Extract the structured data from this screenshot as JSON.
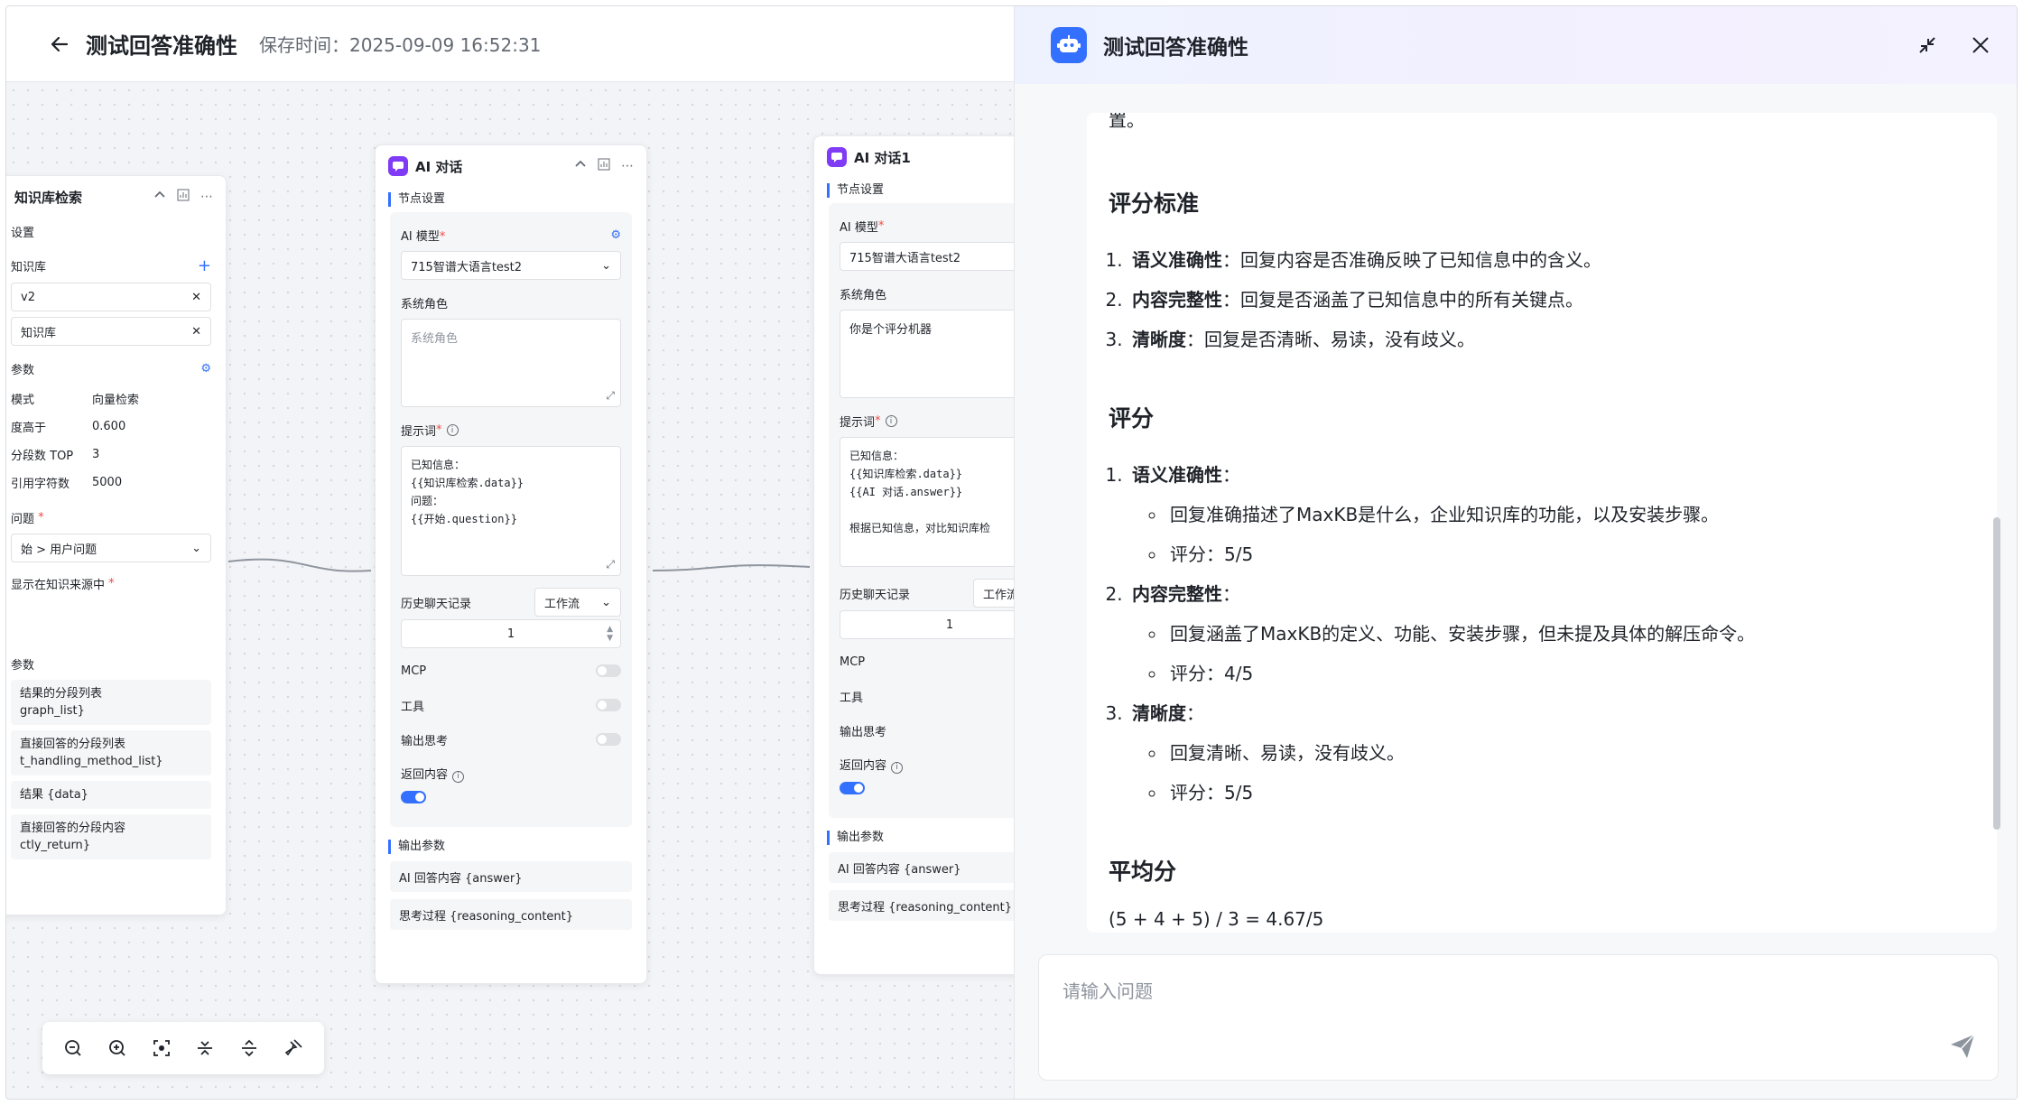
{
  "header": {
    "title": "测试回答准确性",
    "save_time": "保存时间：2025-09-09 16:52:31"
  },
  "kb_node": {
    "title": "知识库检索",
    "settings_label": "设置",
    "kb_label": "知识库",
    "kb_items": [
      "v2",
      "知识库"
    ],
    "params_label": "参数",
    "params": [
      {
        "k": "模式",
        "v": "向量检索"
      },
      {
        "k": "度高于",
        "v": "0.600"
      },
      {
        "k": "分段数 TOP",
        "v": "3"
      },
      {
        "k": "引用字符数",
        "v": "5000"
      }
    ],
    "question_label": "问题",
    "question_value": "始 > 用户问题",
    "show_source_label": "显示在知识来源中",
    "output_label": "参数",
    "outputs": [
      "结果的分段列表\ngraph_list}",
      "直接回答的分段列表\nt_handling_method_list}",
      "结果 {data}",
      "直接回答的分段内容\nctly_return}"
    ]
  },
  "ai_node": {
    "title": "AI 对话",
    "settings_label": "节点设置",
    "model_label": "AI 模型",
    "model_value": "715智谱大语言test2",
    "role_label": "系统角色",
    "role_placeholder": "系统角色",
    "prompt_label": "提示词",
    "prompt_text": "已知信息：\n{{知识库检索.data}}\n问题：\n{{开始.question}}",
    "history_label": "历史聊天记录",
    "history_type": "工作流",
    "history_count": "1",
    "mcp_label": "MCP",
    "tool_label": "工具",
    "think_label": "输出思考",
    "return_label": "返回内容",
    "output_label": "输出参数",
    "outputs": [
      "AI 回答内容 {answer}",
      "思考过程 {reasoning_content}"
    ]
  },
  "ai_node2": {
    "title": "AI 对话1",
    "settings_label": "节点设置",
    "model_label": "AI 模型",
    "model_value": "715智谱大语言test2",
    "role_label": "系统角色",
    "role_value": "你是个评分机器",
    "prompt_label": "提示词",
    "prompt_text": "已知信息：\n{{知识库检索.data}}\n{{AI 对话.answer}}\n\n根据已知信息，对比知识库检",
    "history_label": "历史聊天记录",
    "history_type": "工作流",
    "history_count": "1",
    "mcp_label": "MCP",
    "tool_label": "工具",
    "think_label": "输出思考",
    "return_label": "返回内容",
    "output_label": "输出参数",
    "outputs": [
      "AI 回答内容 {answer}",
      "思考过程 {reasoning_content}"
    ]
  },
  "drawer": {
    "title": "测试回答准确性",
    "input_placeholder": "请输入问题"
  },
  "answer": {
    "tail": "置。",
    "criteria_heading": "评分标准",
    "criteria": [
      {
        "name": "语义准确性",
        "desc": "：回复内容是否准确反映了已知信息中的含义。"
      },
      {
        "name": "内容完整性",
        "desc": "：回复是否涵盖了已知信息中的所有关键点。"
      },
      {
        "name": "清晰度",
        "desc": "：回复是否清晰、易读，没有歧义。"
      }
    ],
    "score_heading": "评分",
    "scores": [
      {
        "name": "语义准确性",
        "comment": "回复准确描述了MaxKB是什么，企业知识库的功能，以及安装步骤。",
        "score": "评分：5/5"
      },
      {
        "name": "内容完整性",
        "comment": "回复涵盖了MaxKB的定义、功能、安装步骤，但未提及具体的解压命令。",
        "score": "评分：4/5"
      },
      {
        "name": "清晰度",
        "comment": "回复清晰、易读，没有歧义。",
        "score": "评分：5/5"
      }
    ],
    "avg_heading": "平均分",
    "avg_formula": "(5 + 4 + 5) / 3 = 4.67/5"
  },
  "colors": {
    "accent": "#3370ff",
    "node_icon": "#7f3bf5"
  }
}
